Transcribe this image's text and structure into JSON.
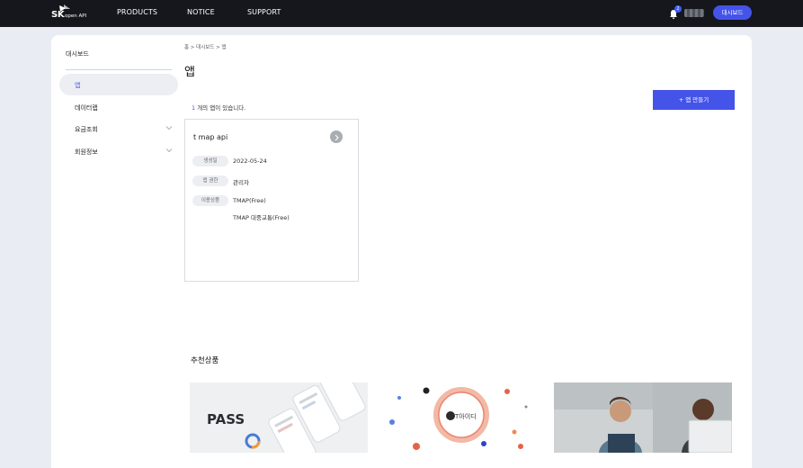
{
  "brand": {
    "sk": "SK",
    "sub": "open API"
  },
  "nav": {
    "products": "PRODUCTS",
    "notice": "NOTICE",
    "support": "SUPPORT"
  },
  "header": {
    "badge_count": "2",
    "dashboard_button": "대시보드"
  },
  "sidebar": {
    "title": "대시보드",
    "items": [
      {
        "label": "앱"
      },
      {
        "label": "데이터랩"
      },
      {
        "label": "요금조회"
      },
      {
        "label": "회원정보"
      }
    ]
  },
  "main": {
    "breadcrumb": "홈 > 대시보드 > 앱",
    "title": "앱",
    "count_number": "1",
    "count_suffix": " 개의 앱이 있습니다.",
    "create_button": "+ 앱 만들기"
  },
  "app_card": {
    "name": "t map api",
    "created_label": "생성일",
    "created_value": "2022-05-24",
    "role_label": "앱 권한",
    "role_value": "관리자",
    "products_label": "이용상품",
    "products": [
      "TMAP(Free)",
      "TMAP 대중교통(Free)"
    ]
  },
  "recommend": {
    "title": "추천상품",
    "card1_text": "PASS",
    "card2_text": "T아이디"
  },
  "colors": {
    "accent": "#4453e8",
    "topbar": "#15171c",
    "background": "#e9ecf3"
  }
}
